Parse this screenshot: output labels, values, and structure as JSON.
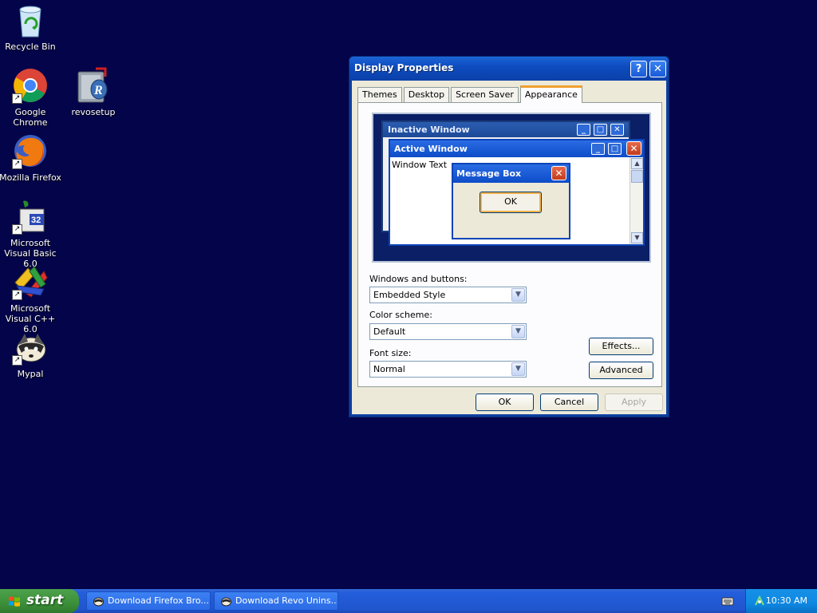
{
  "desktop": {
    "icons": [
      {
        "label": "Recycle Bin"
      },
      {
        "label": "Google Chrome"
      },
      {
        "label": "revosetup"
      },
      {
        "label": "Mozilla Firefox"
      },
      {
        "label": "Microsoft Visual Basic 6.0"
      },
      {
        "label": "Microsoft Visual C++ 6.0"
      },
      {
        "label": "Mypal"
      }
    ]
  },
  "dialog": {
    "title": "Display Properties",
    "help_label": "?",
    "close_label": "✕",
    "tabs": [
      {
        "label": "Themes"
      },
      {
        "label": "Desktop"
      },
      {
        "label": "Screen Saver"
      },
      {
        "label": "Appearance",
        "active": true
      }
    ],
    "preview": {
      "inactive_title": "Inactive Window",
      "active_title": "Active Window",
      "window_text": "Window Text",
      "message_title": "Message Box",
      "ok_label": "OK"
    },
    "fields": {
      "windows_buttons_label": "Windows and buttons:",
      "windows_buttons_value": "Embedded Style",
      "color_scheme_label": "Color scheme:",
      "color_scheme_value": "Default",
      "font_size_label": "Font size:",
      "font_size_value": "Normal"
    },
    "buttons": {
      "effects": "Effects...",
      "advanced": "Advanced",
      "ok": "OK",
      "cancel": "Cancel",
      "apply": "Apply"
    }
  },
  "taskbar": {
    "start_label": "start",
    "tasks": [
      {
        "label": "Download Firefox Bro..."
      },
      {
        "label": "Download Revo Unins..."
      }
    ],
    "clock": "10:30 AM"
  },
  "colors": {
    "desktop_bg": "#04044a",
    "title_blue": "#0c44b8",
    "dialog_face": "#ece9d8",
    "start_green": "#3c8f3a"
  }
}
